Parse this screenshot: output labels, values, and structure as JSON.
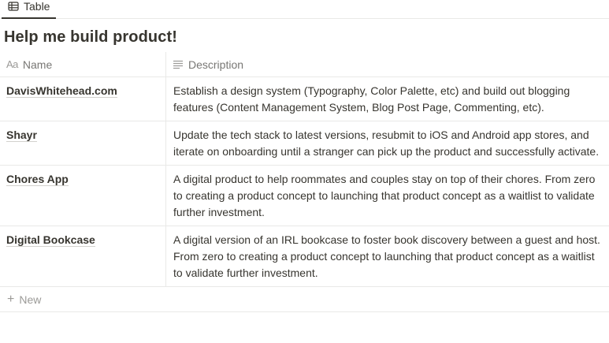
{
  "view": {
    "tab_label": "Table",
    "tab_icon": "table-icon"
  },
  "page": {
    "title": "Help me build product!"
  },
  "table": {
    "columns": [
      {
        "icon": "Aa",
        "label": "Name"
      },
      {
        "icon": "text-lines-icon",
        "label": "Description"
      }
    ],
    "rows": [
      {
        "name": "DavisWhitehead.com",
        "description": "Establish a design system (Typography, Color Palette, etc) and build out blogging features (Content Management System, Blog Post Page, Commenting, etc)."
      },
      {
        "name": "Shayr",
        "description": "Update the tech stack to latest versions, resubmit to iOS and Android app stores, and iterate on onboarding until a stranger can pick up the product and successfully activate."
      },
      {
        "name": "Chores App",
        "description": "A digital product to help roommates and couples stay on top of their chores. From zero to creating a product concept to launching that product concept as a waitlist to validate further investment."
      },
      {
        "name": "Digital Bookcase",
        "description": "A digital version of an IRL bookcase to foster book discovery between a guest and host. From zero to creating a product concept to launching that product concept as a waitlist to validate further investment."
      }
    ],
    "new_label": "New"
  }
}
